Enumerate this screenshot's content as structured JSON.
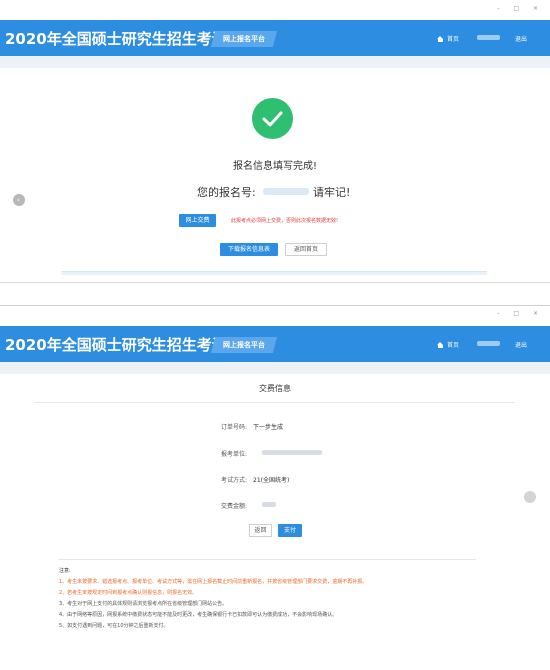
{
  "window_controls": "- □ ×",
  "header": {
    "title": "2020年全国硕士研究生招生考试",
    "platform": "网上报名平台",
    "home": "首页",
    "logout": "退出"
  },
  "screen1": {
    "done_text": "报名信息填写完成!",
    "regno_label": "您的报名号:",
    "regno_tail": "请牢记!",
    "pay_online_button": "网上交费",
    "warning": "此报考点必须网上交费，否则此次报名数据无效!",
    "download_button": "下载报名信息表",
    "back_home_button": "返回首页"
  },
  "screen2": {
    "title": "交费信息",
    "order_label": "订单号码:",
    "order_value": "下一步生成",
    "unit_label": "报考单位:",
    "method_label": "考试方式:",
    "method_value": "21(全国统考)",
    "amount_label": "交费金额:",
    "back_button": "返回",
    "pay_button": "支付",
    "notes_title": "注意:",
    "notes": [
      "1、考生未按要求、错选报考点、报考单位、考试方式等，需在网上报名截止时间前重新报名，并按省级管理部门要求交费，逾期不再补报。",
      "2、若考生未按规定时间到报考点确认则报信息，则报名无效。",
      "3、考生对于网上支付的具体规则请浏览报考点所在省级管理部门网站公告。",
      "4、由于网络等原因，网报系统中缴费状态可能不能及时更改，考生确保银行卡已扣款即可认为缴费成功，不会影响现场确认。",
      "5、如支付遇到问题，可在10分钟之后重新支付。"
    ]
  },
  "colors": {
    "header_blue": "#2d8de0",
    "success_green": "#2fbf71",
    "warning_red": "#e23b3b",
    "note_orange": "#e86a2a"
  }
}
